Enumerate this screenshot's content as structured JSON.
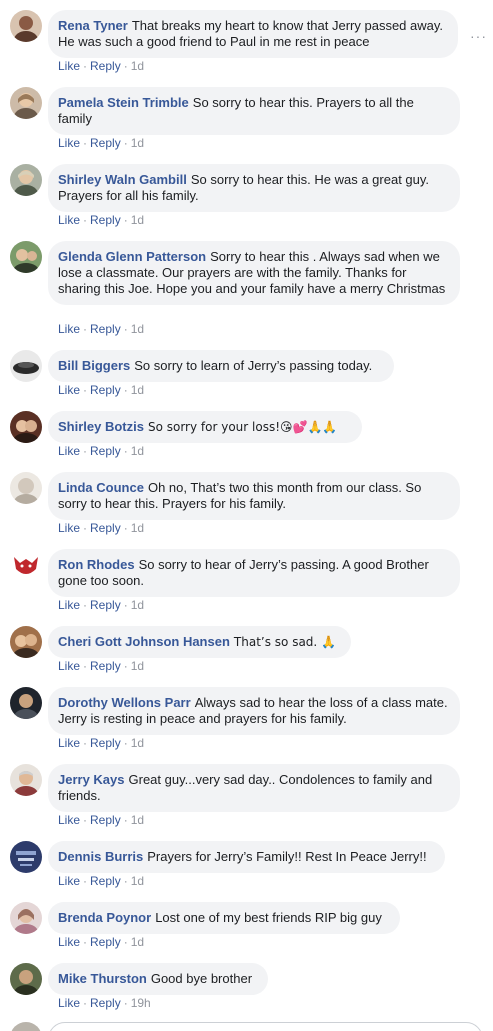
{
  "comments": [
    {
      "author": "Rena Tyner",
      "text": "That breaks my heart to know that Jerry passed away. He was such a good friend to Paul in me rest in peace",
      "like": "Like",
      "reply": "Reply",
      "time": "1d",
      "avatar_color": "#8a5a44"
    },
    {
      "author": "Pamela Stein Trimble",
      "text": "So sorry to hear this. Prayers to all the family",
      "like": "Like",
      "reply": "Reply",
      "time": "1d",
      "avatar_color": "#a98a6c"
    },
    {
      "author": "Shirley Waln Gambill",
      "text": "So sorry to hear this. He was a great guy. Prayers for all his family.",
      "like": "Like",
      "reply": "Reply",
      "time": "1d",
      "avatar_color": "#6f7b6a"
    },
    {
      "author": "Glenda Glenn Patterson",
      "text": "Sorry to hear this . Always sad when we lose a classmate. Our prayers are with the family. Thanks for sharing this Joe. Hope you and your family have a merry Christmas",
      "like": "Like",
      "reply": "Reply",
      "time": "1d",
      "avatar_color": "#4f6b3f"
    },
    {
      "author": "Bill Biggers",
      "text": "So sorry to learn of Jerry’s passing today.",
      "like": "Like",
      "reply": "Reply",
      "time": "1d",
      "avatar_color": "#3a3a3a"
    },
    {
      "author": "Shirley Botzis",
      "text": "So sorry for your loss!😘💕🙏🙏",
      "like": "Like",
      "reply": "Reply",
      "time": "1d",
      "avatar_color": "#7a4a3a"
    },
    {
      "author": "Linda Counce",
      "text": "Oh no, That’s two this month from our class. So sorry to hear this. Prayers for his family.",
      "like": "Like",
      "reply": "Reply",
      "time": "1d",
      "avatar_color": "#c9c2b8"
    },
    {
      "author": "Ron Rhodes",
      "text": "So sorry to hear of Jerry’s passing. A good Brother gone too soon.",
      "like": "Like",
      "reply": "Reply",
      "time": "1d",
      "avatar_color": "#c0282d"
    },
    {
      "author": "Cheri Gott Johnson Hansen",
      "text": "That’s so sad. 🙏",
      "like": "Like",
      "reply": "Reply",
      "time": "1d",
      "avatar_color": "#8c6a4c"
    },
    {
      "author": "Dorothy Wellons Parr",
      "text": "Always sad to hear the loss of a class mate. Jerry is resting in peace and prayers for his family.",
      "like": "Like",
      "reply": "Reply",
      "time": "1d",
      "avatar_color": "#2f3540"
    },
    {
      "author": "Jerry Kays",
      "text": "Great guy...very sad day.. Condolences to family and friends.",
      "like": "Like",
      "reply": "Reply",
      "time": "1d",
      "avatar_color": "#b08f74"
    },
    {
      "author": "Dennis Burris",
      "text": "Prayers for Jerry’s Family!! Rest In Peace Jerry!!",
      "like": "Like",
      "reply": "Reply",
      "time": "1d",
      "avatar_color": "#2d3b6b"
    },
    {
      "author": "Brenda Poynor",
      "text": "Lost one of my best friends RIP big guy",
      "like": "Like",
      "reply": "Reply",
      "time": "1d",
      "avatar_color": "#b79a9a"
    },
    {
      "author": "Mike Thurston",
      "text": "Good bye brother",
      "like": "Like",
      "reply": "Reply",
      "time": "19h",
      "avatar_color": "#3d4a32"
    }
  ],
  "more_icon": "more-options-icon",
  "colors": {
    "link": "#385898",
    "bubble": "#f2f3f5",
    "meta": "#90949c"
  }
}
